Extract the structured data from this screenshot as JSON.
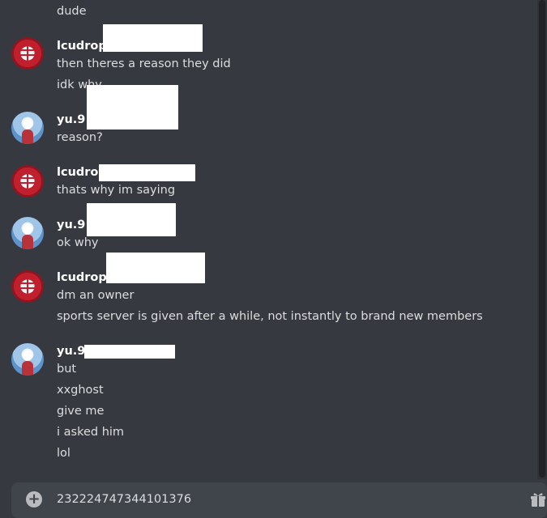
{
  "messages": [
    {
      "author": "",
      "lines": [
        "dude"
      ]
    },
    {
      "author": "lcudrop",
      "avatar": "red-avatar",
      "lines": [
        "then theres a reason they did",
        "idk why"
      ]
    },
    {
      "author": "yu.9",
      "avatar": "blue-avatar",
      "lines": [
        "reason?"
      ]
    },
    {
      "author": "lcudrop",
      "avatar": "red-avatar",
      "lines": [
        "thats why im saying"
      ]
    },
    {
      "author": "yu.9",
      "avatar": "blue-avatar",
      "lines": [
        "ok why"
      ]
    },
    {
      "author": "lcudrop",
      "avatar": "red-avatar",
      "lines": [
        "dm an owner",
        "sports server is given after a while, not instantly to brand new members"
      ]
    },
    {
      "author": "yu.9",
      "avatar": "blue-avatar",
      "lines": [
        "but",
        "xxghost",
        "give me",
        "i asked him",
        "lol"
      ]
    }
  ],
  "composer": {
    "value": "232224747344101376",
    "icons": [
      "add-attachment-icon",
      "gift-icon"
    ]
  },
  "colors": {
    "background": "#36393f",
    "composer": "#40444b",
    "text": "#dcddde",
    "author": "#ffffff"
  }
}
